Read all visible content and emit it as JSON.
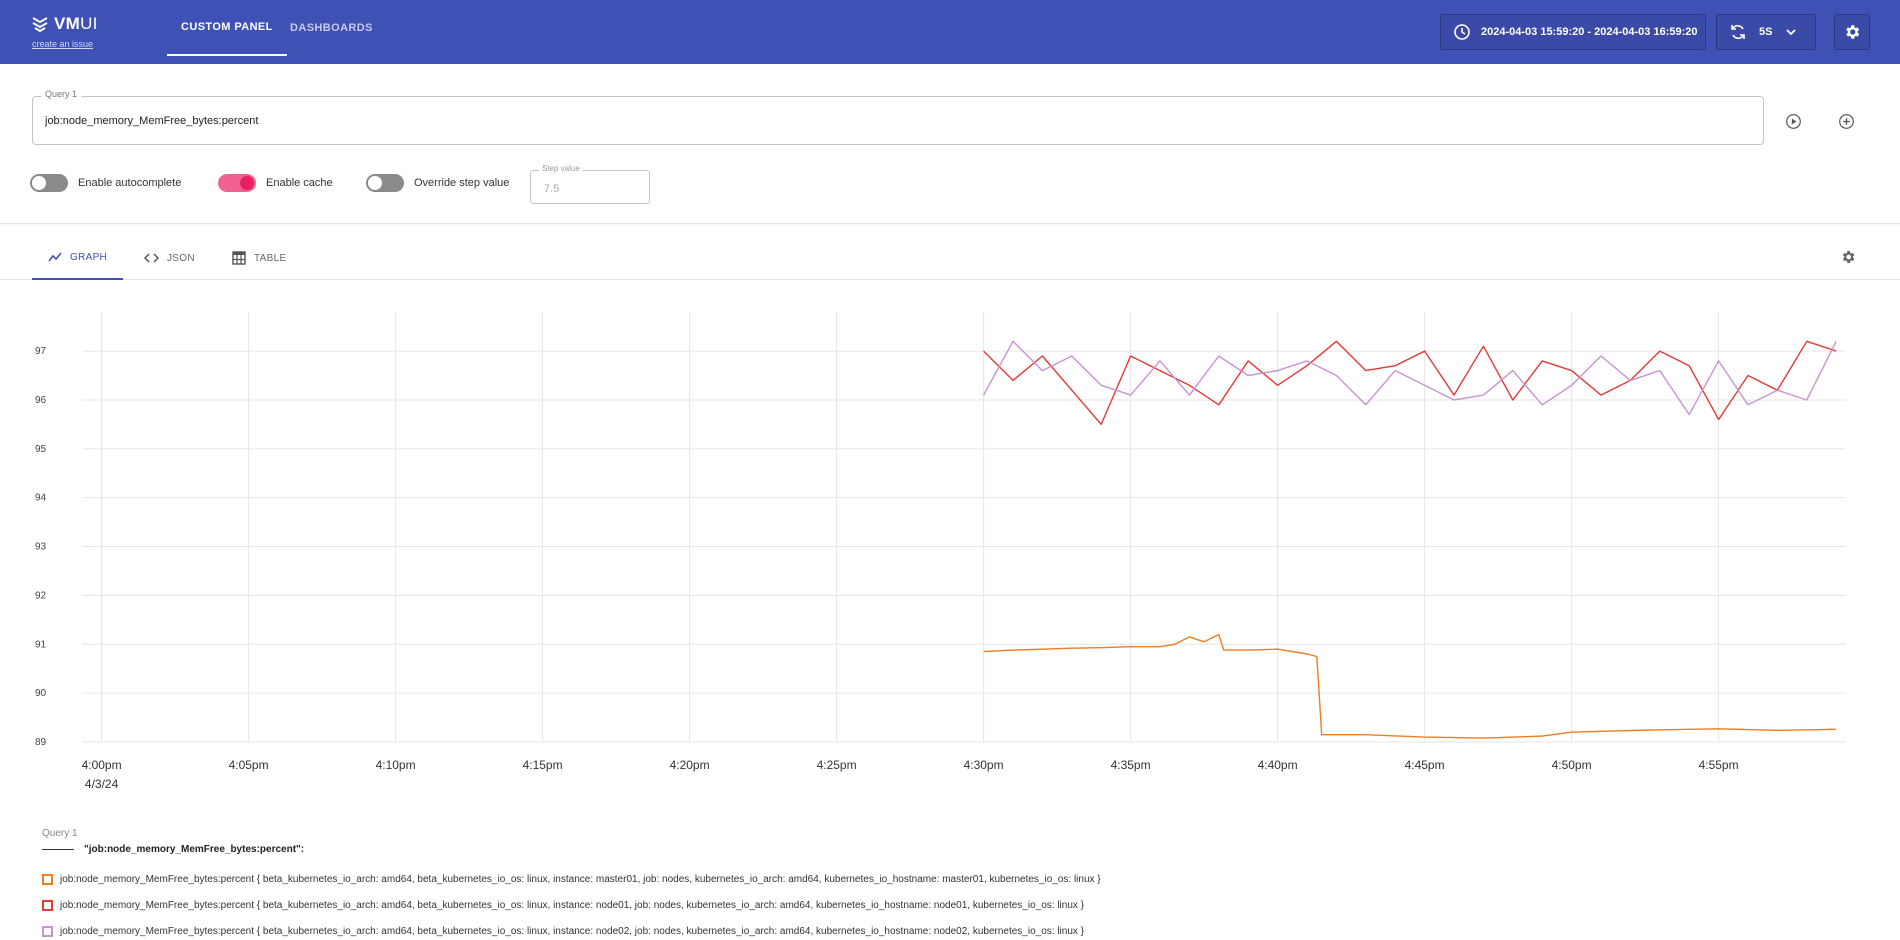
{
  "header": {
    "logo_main": "VM",
    "logo_ui": "UI",
    "create_issue": "create an issue",
    "nav": [
      "CUSTOM PANEL",
      "DASHBOARDS"
    ],
    "time_range": "2024-04-03 15:59:20 - 2024-04-03 16:59:20",
    "refresh_interval": "5s"
  },
  "query": {
    "label": "Query 1",
    "value": "job:node_memory_MemFree_bytes:percent"
  },
  "toggles": [
    {
      "label": "Enable autocomplete",
      "on": false
    },
    {
      "label": "Enable cache",
      "on": true
    },
    {
      "label": "Override step value",
      "on": false
    }
  ],
  "step": {
    "label": "Step value",
    "placeholder": "7.5"
  },
  "tabs": [
    "GRAPH",
    "JSON",
    "TABLE"
  ],
  "chart_data": {
    "type": "line",
    "x_ticks": [
      "4:00pm",
      "4:05pm",
      "4:10pm",
      "4:15pm",
      "4:20pm",
      "4:25pm",
      "4:30pm",
      "4:35pm",
      "4:40pm",
      "4:45pm",
      "4:50pm",
      "4:55pm"
    ],
    "x_date_label": "4/3/24",
    "y_ticks": [
      "97",
      "96",
      "95",
      "94",
      "93",
      "92",
      "91",
      "90",
      "89"
    ],
    "xlim": [
      "15:59:20",
      "16:59:20"
    ],
    "ylim": [
      89,
      97.8
    ],
    "grid": true,
    "series": [
      {
        "name": "job:node_memory_MemFree_bytes:percent { beta_kubernetes_io_arch: amd64, beta_kubernetes_io_os: linux, instance: master01, job: nodes, kubernetes_io_arch: amd64, kubernetes_io_hostname: master01, kubernetes_io_os: linux }",
        "color": "#f07d1e",
        "x": [
          "16:30",
          "16:31",
          "16:32",
          "16:33",
          "16:34",
          "16:35",
          "16:36",
          "16:36:30",
          "16:37",
          "16:37:30",
          "16:38",
          "16:38:10",
          "16:39",
          "16:40",
          "16:41",
          "16:41:20",
          "16:41:30",
          "16:43",
          "16:45",
          "16:47",
          "16:49",
          "16:50",
          "16:51",
          "16:53",
          "16:55",
          "16:57",
          "16:59"
        ],
        "y": [
          90.85,
          90.88,
          90.9,
          90.92,
          90.93,
          90.95,
          90.95,
          91.0,
          91.15,
          91.05,
          91.2,
          90.88,
          90.88,
          90.9,
          90.8,
          90.75,
          89.15,
          89.15,
          89.1,
          89.08,
          89.12,
          89.2,
          89.22,
          89.25,
          89.27,
          89.24,
          89.26
        ]
      },
      {
        "name": "job:node_memory_MemFree_bytes:percent { beta_kubernetes_io_arch: amd64, beta_kubernetes_io_os: linux, instance: node01, job: nodes, kubernetes_io_arch: amd64, kubernetes_io_hostname: node01, kubernetes_io_os: linux }",
        "color": "#e53935",
        "x": [
          "16:30",
          "16:31",
          "16:32",
          "16:33",
          "16:34",
          "16:35",
          "16:36",
          "16:37",
          "16:38",
          "16:39",
          "16:40",
          "16:41",
          "16:42",
          "16:43",
          "16:44",
          "16:45",
          "16:46",
          "16:47",
          "16:48",
          "16:49",
          "16:50",
          "16:51",
          "16:52",
          "16:53",
          "16:54",
          "16:55",
          "16:56",
          "16:57",
          "16:58",
          "16:59"
        ],
        "y": [
          97.0,
          96.4,
          96.9,
          96.2,
          95.5,
          96.9,
          96.6,
          96.3,
          95.9,
          96.8,
          96.3,
          96.7,
          97.2,
          96.6,
          96.7,
          97.0,
          96.1,
          97.1,
          96.0,
          96.8,
          96.6,
          96.1,
          96.4,
          97.0,
          96.7,
          95.6,
          96.5,
          96.2,
          97.2,
          97.0
        ]
      },
      {
        "name": "job:node_memory_MemFree_bytes:percent { beta_kubernetes_io_arch: amd64, beta_kubernetes_io_os: linux, instance: node02, job: nodes, kubernetes_io_arch: amd64, kubernetes_io_hostname: node02, kubernetes_io_os: linux }",
        "color": "#c993d1",
        "x": [
          "16:30",
          "16:31",
          "16:32",
          "16:33",
          "16:34",
          "16:35",
          "16:36",
          "16:37",
          "16:38",
          "16:39",
          "16:40",
          "16:41",
          "16:42",
          "16:43",
          "16:44",
          "16:45",
          "16:46",
          "16:47",
          "16:48",
          "16:49",
          "16:50",
          "16:51",
          "16:52",
          "16:53",
          "16:54",
          "16:55",
          "16:56",
          "16:57",
          "16:58",
          "16:59"
        ],
        "y": [
          96.1,
          97.2,
          96.6,
          96.9,
          96.3,
          96.1,
          96.8,
          96.1,
          96.9,
          96.5,
          96.6,
          96.8,
          96.5,
          95.9,
          96.6,
          96.3,
          96.0,
          96.1,
          96.6,
          95.9,
          96.3,
          96.9,
          96.4,
          96.6,
          95.7,
          96.8,
          95.9,
          96.2,
          96.0,
          97.2
        ]
      }
    ]
  },
  "legend": {
    "query_label": "Query 1",
    "group_label": "\"job:node_memory_MemFree_bytes:percent\":"
  },
  "colors": {
    "header_bg": "#3f51b5",
    "accent": "#3f51b5",
    "toggle_on": "#e91e63"
  },
  "icons": {
    "logo": "victoriametrics-logo-icon",
    "clock": "clock-icon",
    "refresh": "refresh-icon",
    "chevron": "chevron-down-icon",
    "gear": "gear-icon",
    "play": "play-circle-icon",
    "add": "add-circle-icon",
    "graph": "graph-icon",
    "json": "code-icon",
    "table": "table-icon"
  }
}
